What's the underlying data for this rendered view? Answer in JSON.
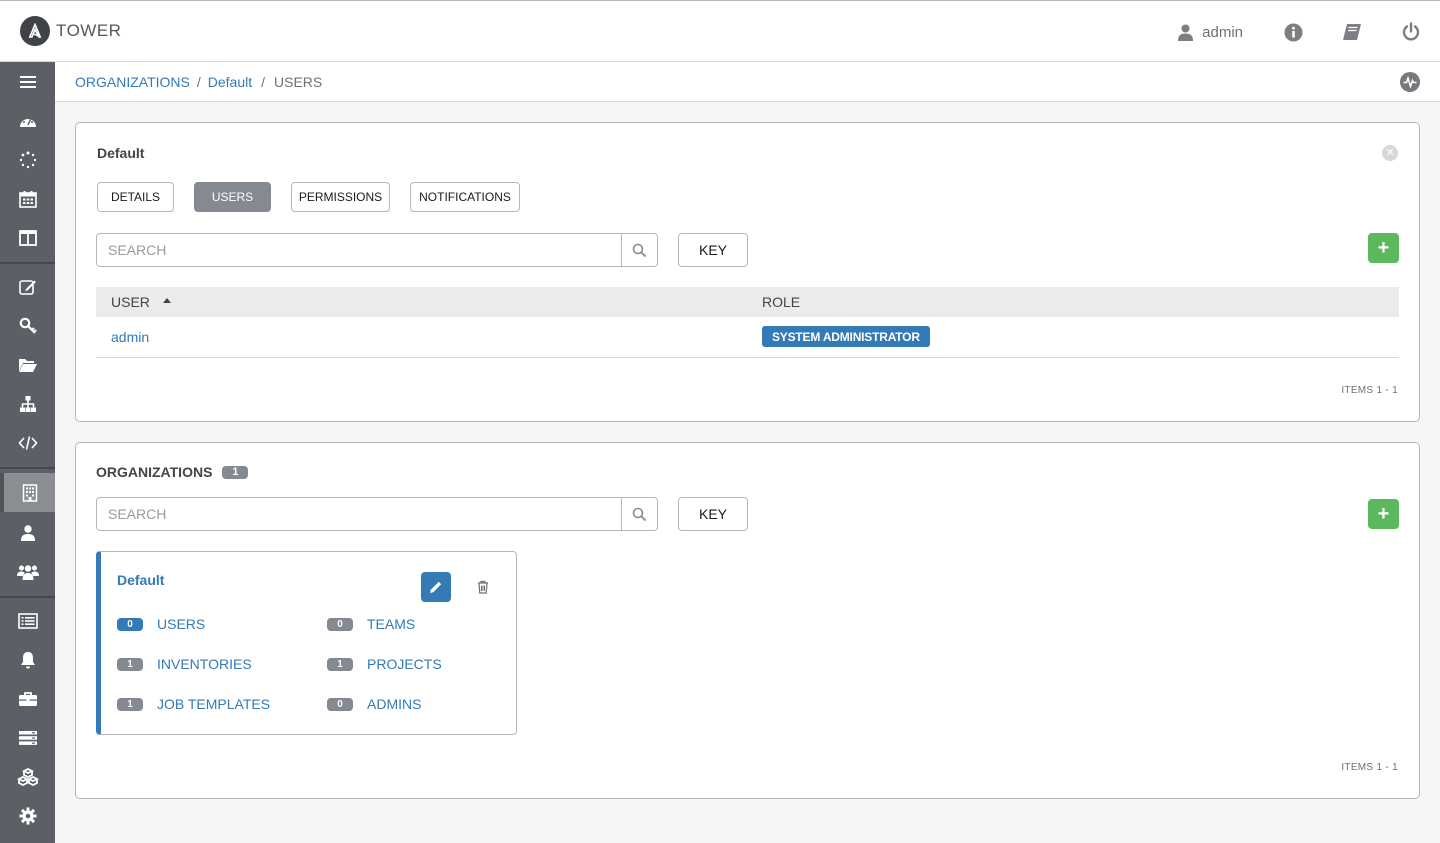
{
  "app": {
    "title": "TOWER"
  },
  "header": {
    "user_name": "admin"
  },
  "breadcrumb": {
    "item1": "ORGANIZATIONS",
    "item2": "Default",
    "current": "USERS",
    "sep": "/"
  },
  "detail_panel": {
    "title": "Default",
    "tabs": [
      "DETAILS",
      "USERS",
      "PERMISSIONS",
      "NOTIFICATIONS"
    ],
    "active_tab": "USERS",
    "search_placeholder": "SEARCH",
    "key_label": "KEY",
    "add_label": "+",
    "columns": {
      "user": "USER",
      "role": "ROLE"
    },
    "rows": [
      {
        "user": "admin",
        "role": "SYSTEM ADMINISTRATOR"
      }
    ],
    "items": "ITEMS  1 - 1"
  },
  "orgs_panel": {
    "title": "ORGANIZATIONS",
    "count": "1",
    "search_placeholder": "SEARCH",
    "key_label": "KEY",
    "add_label": "+",
    "items": "ITEMS  1 - 1",
    "card": {
      "name": "Default",
      "stats": {
        "users": {
          "count": "0",
          "label": "USERS"
        },
        "teams": {
          "count": "0",
          "label": "TEAMS"
        },
        "inventories": {
          "count": "1",
          "label": "INVENTORIES"
        },
        "projects": {
          "count": "1",
          "label": "PROJECTS"
        },
        "job_templates": {
          "count": "1",
          "label": "JOB TEMPLATES"
        },
        "admins": {
          "count": "0",
          "label": "ADMINS"
        }
      }
    }
  },
  "colors": {
    "link": "#337ab7",
    "add": "#5cb85c",
    "sidebar": "#5c6066",
    "tab_active": "#848992"
  },
  "sidebar_icons": [
    "menu-icon",
    "dashboard-icon",
    "jobs-icon",
    "schedules-icon",
    "portal-icon",
    "templates-icon",
    "credentials-icon",
    "projects-icon",
    "inventories-icon",
    "inventory-scripts-icon",
    "organizations-icon",
    "users-icon",
    "teams-icon",
    "credential-types-icon",
    "notifications-icon",
    "management-jobs-icon",
    "instance-groups-icon",
    "applications-icon",
    "settings-icon"
  ]
}
